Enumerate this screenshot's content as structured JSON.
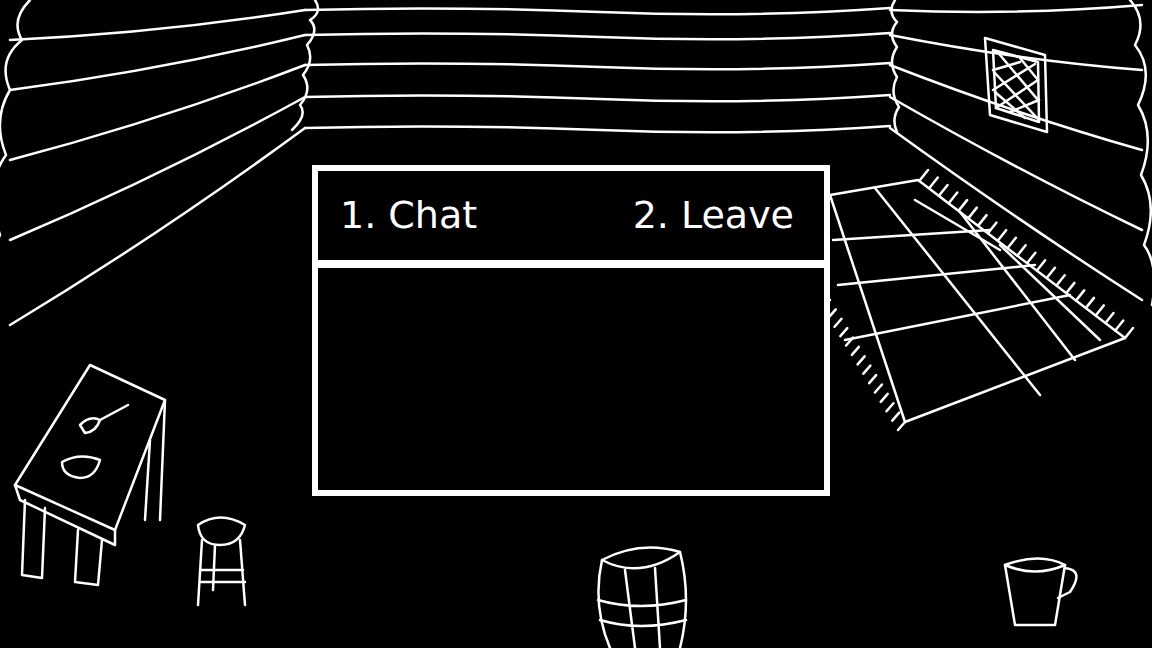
{
  "menu": {
    "options": [
      {
        "label": "1. Chat"
      },
      {
        "label": "2. Leave"
      }
    ]
  }
}
